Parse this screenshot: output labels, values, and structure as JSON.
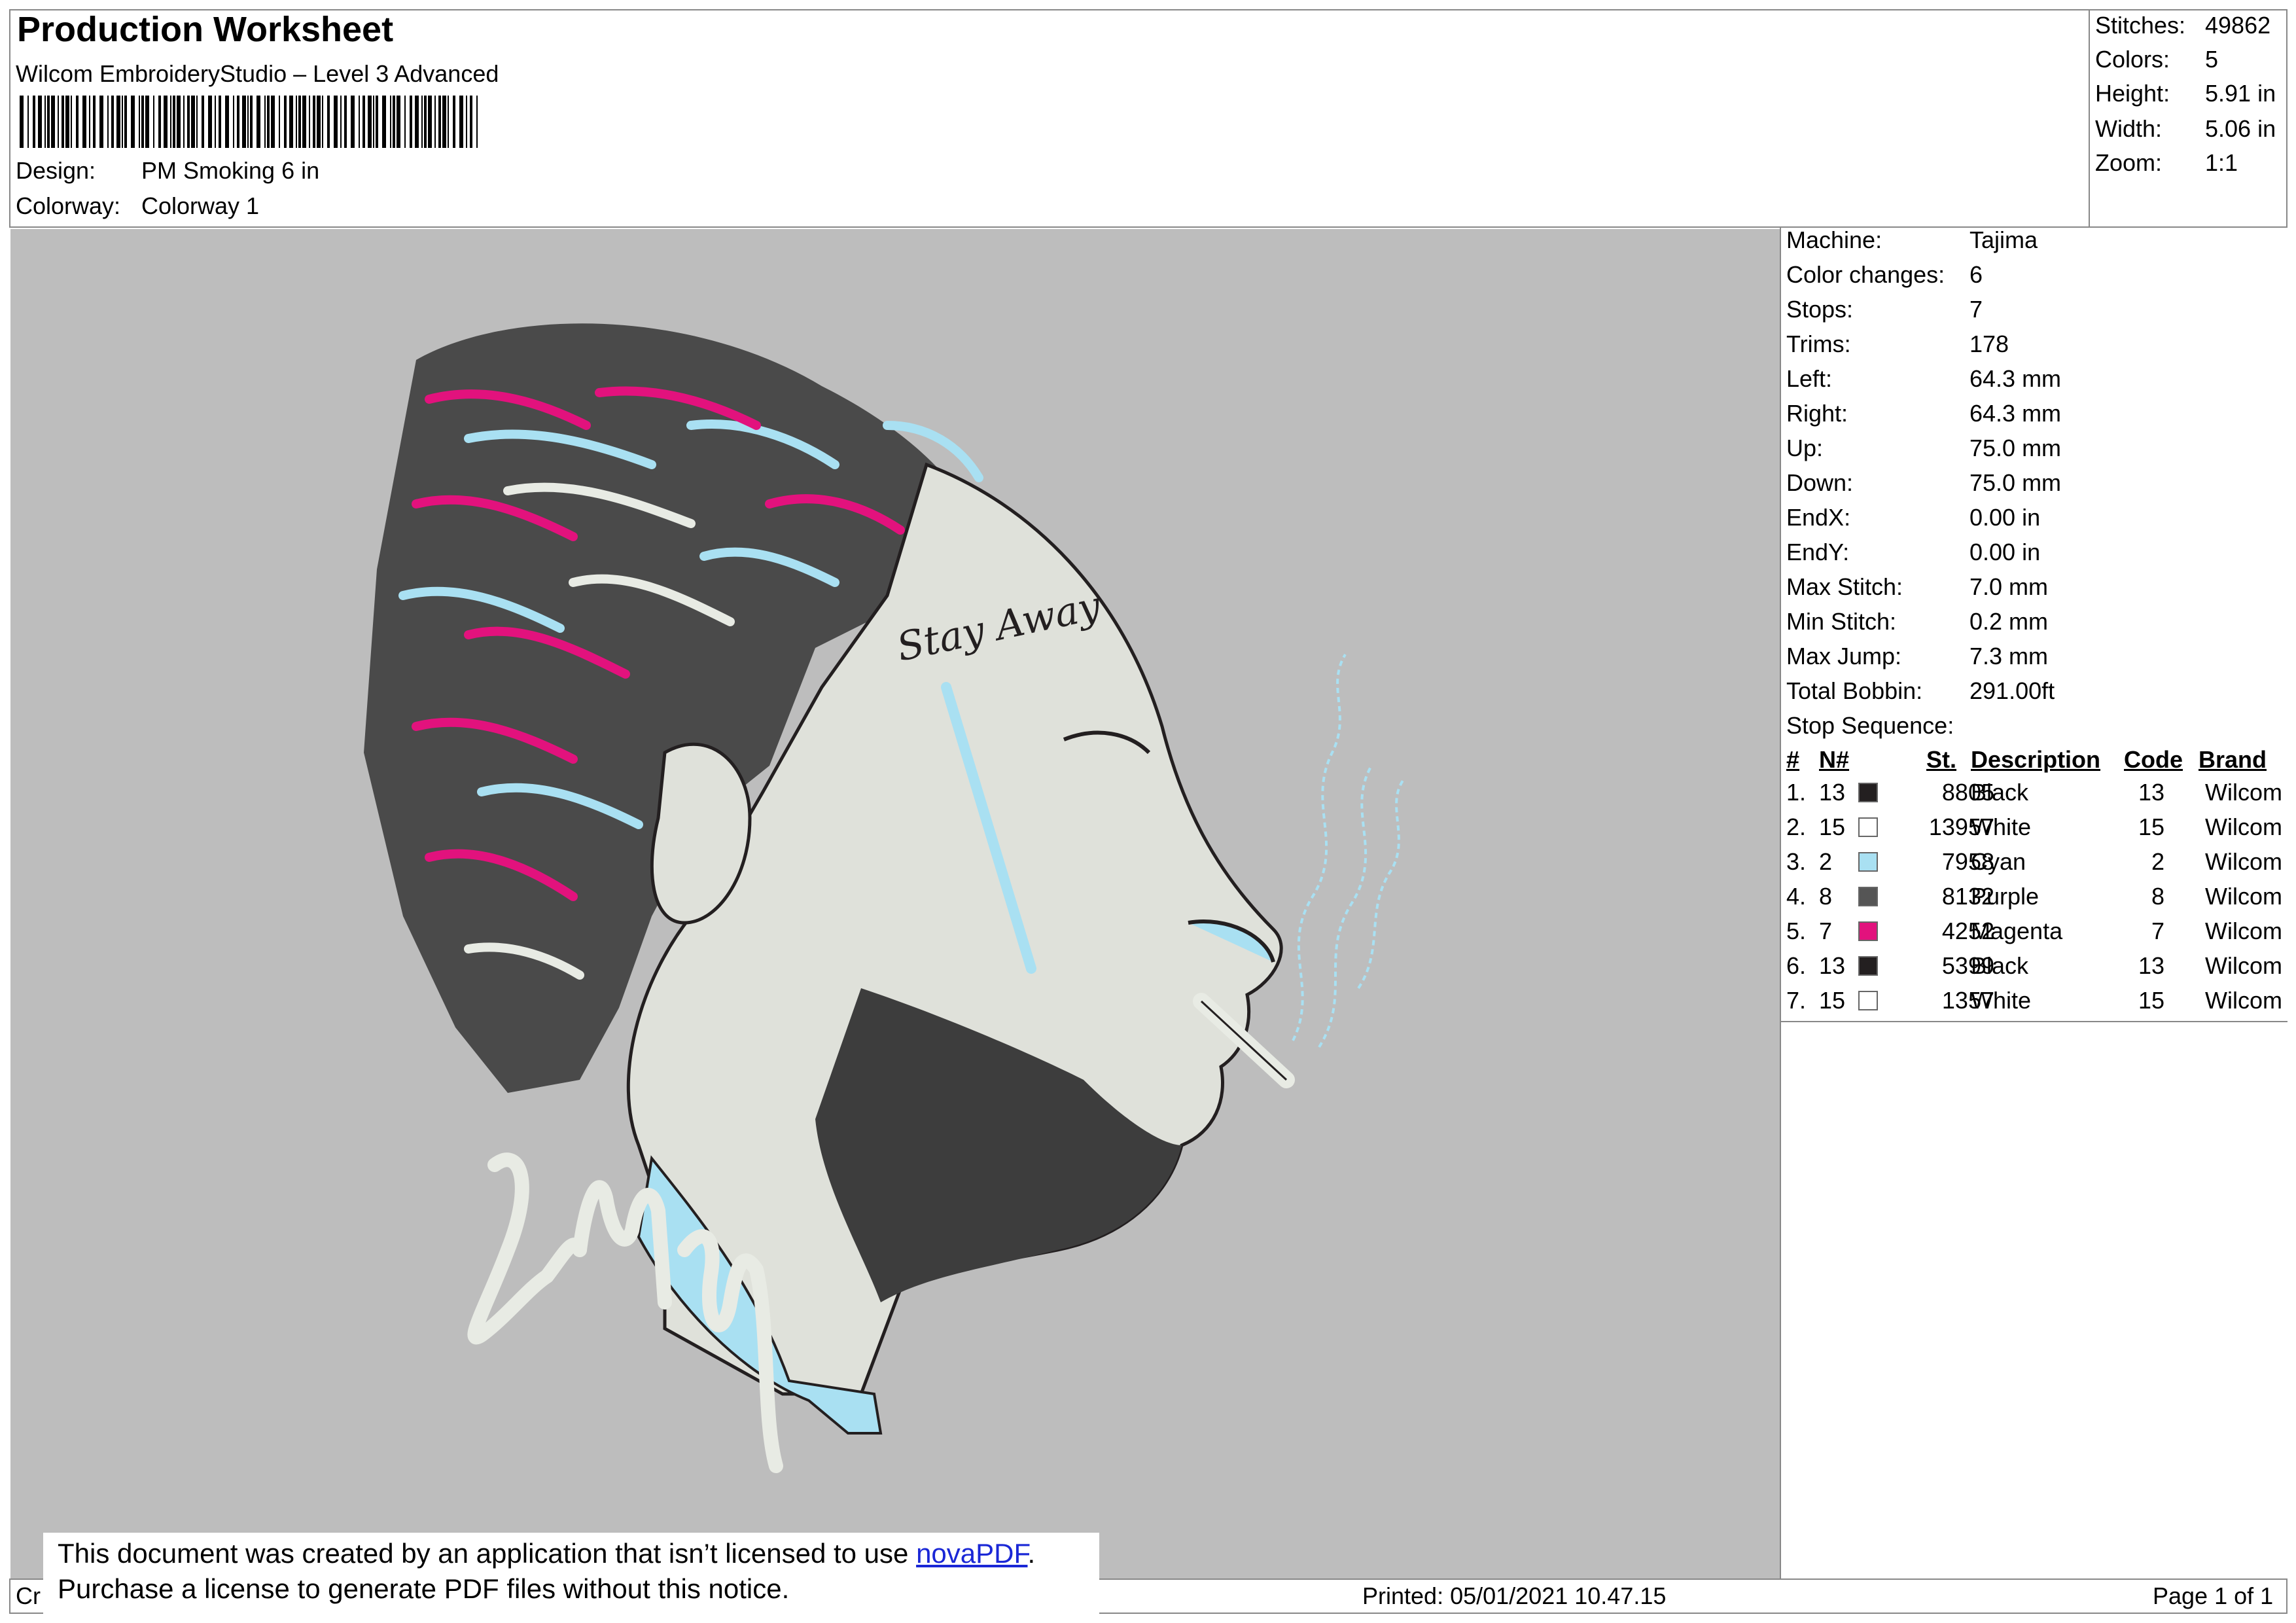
{
  "header": {
    "title": "Production Worksheet",
    "software": "Wilcom EmbroideryStudio – Level 3 Advanced",
    "design_label": "Design:",
    "design_value": "PM Smoking 6 in",
    "colorway_label": "Colorway:",
    "colorway_value": "Colorway 1"
  },
  "stats": {
    "stitches_label": "Stitches:",
    "stitches_value": "49862",
    "colors_label": "Colors:",
    "colors_value": "5",
    "height_label": "Height:",
    "height_value": "5.91 in",
    "width_label": "Width:",
    "width_value": "5.06 in",
    "zoom_label": "Zoom:",
    "zoom_value": "1:1"
  },
  "machine": [
    {
      "label": "Machine:",
      "value": "Tajima"
    },
    {
      "label": "Color changes:",
      "value": "6"
    },
    {
      "label": "Stops:",
      "value": "7"
    },
    {
      "label": "Trims:",
      "value": "178"
    },
    {
      "label": "Left:",
      "value": "64.3 mm"
    },
    {
      "label": "Right:",
      "value": "64.3 mm"
    },
    {
      "label": "Up:",
      "value": "75.0 mm"
    },
    {
      "label": "Down:",
      "value": "75.0 mm"
    },
    {
      "label": "EndX:",
      "value": "0.00 in"
    },
    {
      "label": "EndY:",
      "value": "0.00 in"
    },
    {
      "label": "Max Stitch:",
      "value": "7.0 mm"
    },
    {
      "label": "Min Stitch:",
      "value": "0.2 mm"
    },
    {
      "label": "Max Jump:",
      "value": "7.3 mm"
    },
    {
      "label": "Total Bobbin:",
      "value": "291.00ft"
    }
  ],
  "stop_sequence": {
    "title": "Stop Sequence:",
    "columns": {
      "num": "#",
      "n": "N#",
      "st": "St.",
      "desc": "Description",
      "code": "Code",
      "brand": "Brand"
    },
    "rows": [
      {
        "idx": "1.",
        "n": "13",
        "color": "#231f20",
        "st": "8805",
        "desc": "Black",
        "code": "13",
        "brand": "Wilcom"
      },
      {
        "idx": "2.",
        "n": "15",
        "color": "#ffffff",
        "st": "13957",
        "desc": "White",
        "code": "15",
        "brand": "Wilcom"
      },
      {
        "idx": "3.",
        "n": "2",
        "color": "#a9e0f2",
        "st": "7958",
        "desc": "Cyan",
        "code": "2",
        "brand": "Wilcom"
      },
      {
        "idx": "4.",
        "n": "8",
        "color": "#555555",
        "st": "8132",
        "desc": "Purple",
        "code": "8",
        "brand": "Wilcom"
      },
      {
        "idx": "5.",
        "n": "7",
        "color": "#e2127d",
        "st": "4252",
        "desc": "Magenta",
        "code": "7",
        "brand": "Wilcom"
      },
      {
        "idx": "6.",
        "n": "13",
        "color": "#231f20",
        "st": "5399",
        "desc": "Black",
        "code": "13",
        "brand": "Wilcom"
      },
      {
        "idx": "7.",
        "n": "15",
        "color": "#ffffff",
        "st": "1357",
        "desc": "White",
        "code": "15",
        "brand": "Wilcom"
      }
    ]
  },
  "image": {
    "tattoo_text": "Stay Away"
  },
  "footer": {
    "left": "Cr",
    "printed": "Printed: 05/01/2021 10.47.15",
    "page": "Page 1 of 1"
  },
  "notice": {
    "line1_prefix": "This document was created by an application that isn’t licensed to use ",
    "link": "novaPDF",
    "line1_suffix": ".",
    "line2": "Purchase a license to generate PDF files without this notice."
  },
  "colors": {
    "canvas_bg": "#bdbdbd",
    "thread_black": "#231f20",
    "thread_white": "#e8ebe4",
    "thread_cyan": "#a9e0f2",
    "thread_gray": "#555555",
    "thread_magenta": "#e2127d"
  }
}
